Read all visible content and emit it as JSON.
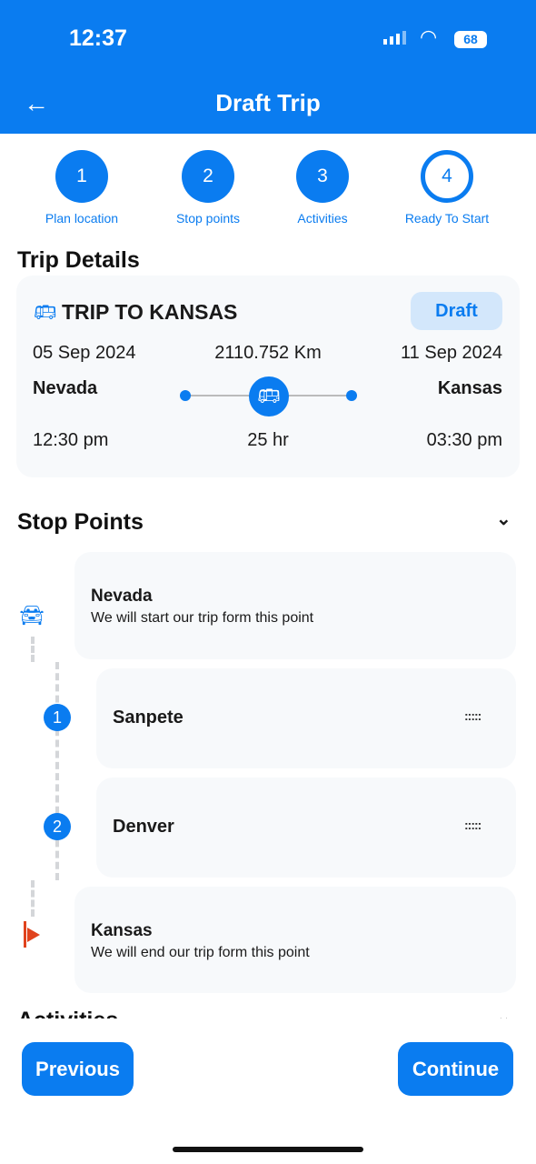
{
  "status_bar": {
    "time": "12:37",
    "battery": "68"
  },
  "header": {
    "title": "Draft Trip",
    "back_icon": "arrow-left-icon"
  },
  "steps": [
    {
      "number": "1",
      "label": "Plan location"
    },
    {
      "number": "2",
      "label": "Stop points"
    },
    {
      "number": "3",
      "label": "Activities"
    },
    {
      "number": "4",
      "label": "Ready To Start",
      "current": true
    }
  ],
  "trip_details": {
    "heading": "Trip Details",
    "name": "TRIP TO KANSAS",
    "status": "Draft",
    "start_date": "05 Sep 2024",
    "distance": "2110.752 Km",
    "end_date": "11 Sep 2024",
    "origin": "Nevada",
    "destination": "Kansas",
    "start_time": "12:30 pm",
    "duration": "25 hr",
    "end_time": "03:30 pm"
  },
  "stop_points": {
    "heading": "Stop Points",
    "start": {
      "name": "Nevada",
      "desc": "We will start our trip form this point"
    },
    "stops": [
      {
        "number": "1",
        "name": "Sanpete"
      },
      {
        "number": "2",
        "name": "Denver"
      }
    ],
    "end": {
      "name": "Kansas",
      "desc": "We will end our trip form this point"
    }
  },
  "activities": {
    "heading": "Activities"
  },
  "footer": {
    "previous": "Previous",
    "continue": "Continue"
  },
  "colors": {
    "primary": "#0a7cf0",
    "flag": "#e0431d",
    "badge_bg": "#d3e7fb"
  }
}
